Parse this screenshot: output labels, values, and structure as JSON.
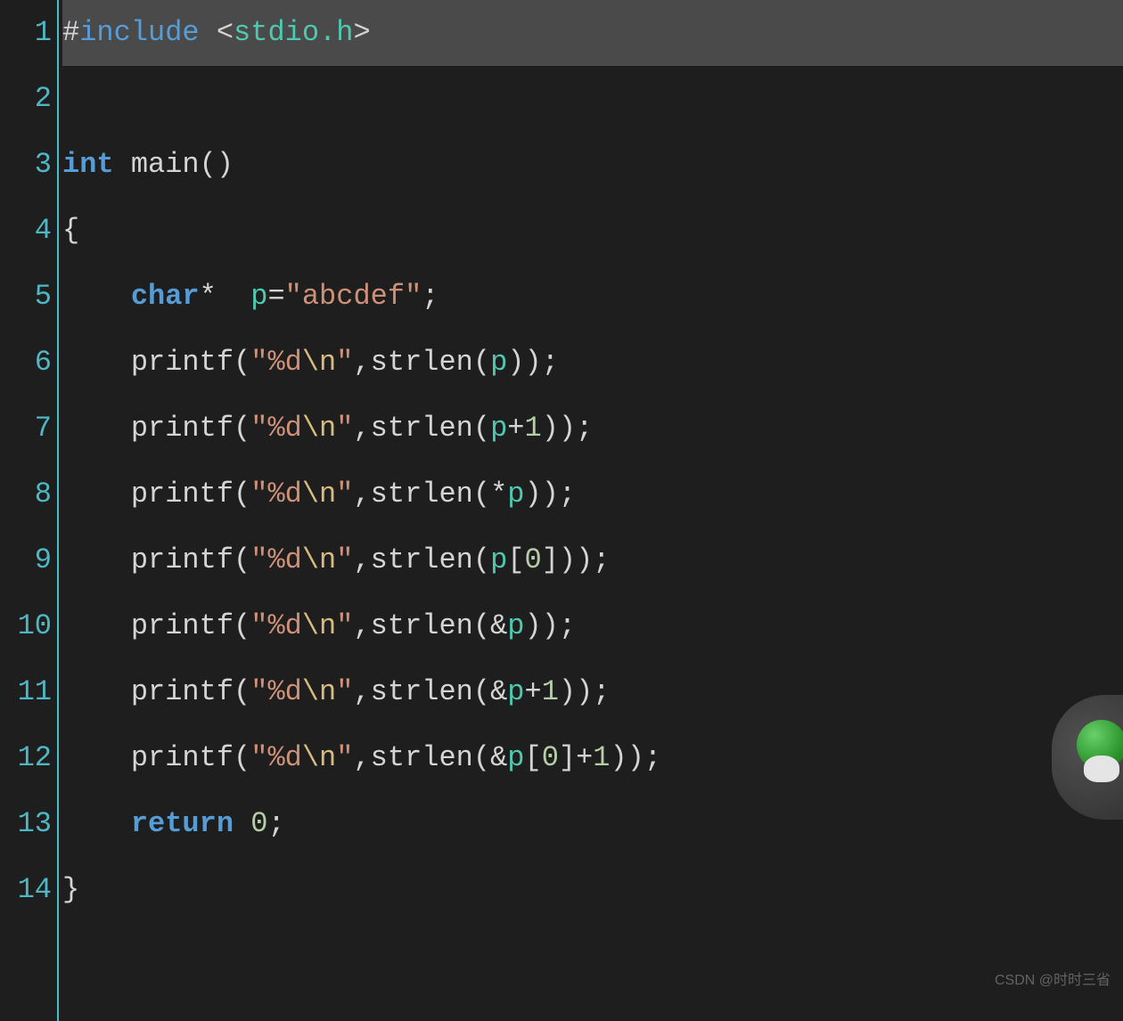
{
  "editor": {
    "highlighted_line_index": 0,
    "lines": [
      {
        "number": "1",
        "tokens": [
          {
            "text": "#",
            "class": "tok-hash"
          },
          {
            "text": "include",
            "class": "tok-preprocessor"
          },
          {
            "text": " ",
            "class": "tok-punct"
          },
          {
            "text": "<",
            "class": "tok-angle"
          },
          {
            "text": "stdio.h",
            "class": "tok-include-path"
          },
          {
            "text": ">",
            "class": "tok-angle"
          }
        ]
      },
      {
        "number": "2",
        "tokens": []
      },
      {
        "number": "3",
        "tokens": [
          {
            "text": "int",
            "class": "tok-type"
          },
          {
            "text": " ",
            "class": "tok-punct"
          },
          {
            "text": "main",
            "class": "tok-function"
          },
          {
            "text": "()",
            "class": "tok-punct"
          }
        ]
      },
      {
        "number": "4",
        "tokens": [
          {
            "text": "{",
            "class": "tok-punct"
          }
        ]
      },
      {
        "number": "5",
        "indent": true,
        "tokens": [
          {
            "text": "    ",
            "class": "tok-punct"
          },
          {
            "text": "char",
            "class": "tok-type"
          },
          {
            "text": "*  ",
            "class": "tok-punct"
          },
          {
            "text": "p",
            "class": "tok-variable"
          },
          {
            "text": "=",
            "class": "tok-punct"
          },
          {
            "text": "\"abcdef\"",
            "class": "tok-string"
          },
          {
            "text": ";",
            "class": "tok-punct"
          }
        ]
      },
      {
        "number": "6",
        "indent": true,
        "tokens": [
          {
            "text": "    ",
            "class": "tok-punct"
          },
          {
            "text": "printf",
            "class": "tok-function"
          },
          {
            "text": "(",
            "class": "tok-punct"
          },
          {
            "text": "\"%d",
            "class": "tok-string"
          },
          {
            "text": "\\n",
            "class": "tok-escape"
          },
          {
            "text": "\"",
            "class": "tok-string"
          },
          {
            "text": ",",
            "class": "tok-punct"
          },
          {
            "text": "strlen",
            "class": "tok-function"
          },
          {
            "text": "(",
            "class": "tok-punct"
          },
          {
            "text": "p",
            "class": "tok-variable"
          },
          {
            "text": "));",
            "class": "tok-punct"
          }
        ]
      },
      {
        "number": "7",
        "indent": true,
        "tokens": [
          {
            "text": "    ",
            "class": "tok-punct"
          },
          {
            "text": "printf",
            "class": "tok-function"
          },
          {
            "text": "(",
            "class": "tok-punct"
          },
          {
            "text": "\"%d",
            "class": "tok-string"
          },
          {
            "text": "\\n",
            "class": "tok-escape"
          },
          {
            "text": "\"",
            "class": "tok-string"
          },
          {
            "text": ",",
            "class": "tok-punct"
          },
          {
            "text": "strlen",
            "class": "tok-function"
          },
          {
            "text": "(",
            "class": "tok-punct"
          },
          {
            "text": "p",
            "class": "tok-variable"
          },
          {
            "text": "+",
            "class": "tok-punct"
          },
          {
            "text": "1",
            "class": "tok-number"
          },
          {
            "text": "));",
            "class": "tok-punct"
          }
        ]
      },
      {
        "number": "8",
        "indent": true,
        "tokens": [
          {
            "text": "    ",
            "class": "tok-punct"
          },
          {
            "text": "printf",
            "class": "tok-function"
          },
          {
            "text": "(",
            "class": "tok-punct"
          },
          {
            "text": "\"%d",
            "class": "tok-string"
          },
          {
            "text": "\\n",
            "class": "tok-escape"
          },
          {
            "text": "\"",
            "class": "tok-string"
          },
          {
            "text": ",",
            "class": "tok-punct"
          },
          {
            "text": "strlen",
            "class": "tok-function"
          },
          {
            "text": "(*",
            "class": "tok-punct"
          },
          {
            "text": "p",
            "class": "tok-variable"
          },
          {
            "text": "));",
            "class": "tok-punct"
          }
        ]
      },
      {
        "number": "9",
        "indent": true,
        "tokens": [
          {
            "text": "    ",
            "class": "tok-punct"
          },
          {
            "text": "printf",
            "class": "tok-function"
          },
          {
            "text": "(",
            "class": "tok-punct"
          },
          {
            "text": "\"%d",
            "class": "tok-string"
          },
          {
            "text": "\\n",
            "class": "tok-escape"
          },
          {
            "text": "\"",
            "class": "tok-string"
          },
          {
            "text": ",",
            "class": "tok-punct"
          },
          {
            "text": "strlen",
            "class": "tok-function"
          },
          {
            "text": "(",
            "class": "tok-punct"
          },
          {
            "text": "p",
            "class": "tok-variable"
          },
          {
            "text": "[",
            "class": "tok-punct"
          },
          {
            "text": "0",
            "class": "tok-number"
          },
          {
            "text": "]));",
            "class": "tok-punct"
          }
        ]
      },
      {
        "number": "10",
        "indent": true,
        "tokens": [
          {
            "text": "    ",
            "class": "tok-punct"
          },
          {
            "text": "printf",
            "class": "tok-function"
          },
          {
            "text": "(",
            "class": "tok-punct"
          },
          {
            "text": "\"%d",
            "class": "tok-string"
          },
          {
            "text": "\\n",
            "class": "tok-escape"
          },
          {
            "text": "\"",
            "class": "tok-string"
          },
          {
            "text": ",",
            "class": "tok-punct"
          },
          {
            "text": "strlen",
            "class": "tok-function"
          },
          {
            "text": "(&",
            "class": "tok-punct"
          },
          {
            "text": "p",
            "class": "tok-variable"
          },
          {
            "text": "));",
            "class": "tok-punct"
          }
        ]
      },
      {
        "number": "11",
        "indent": true,
        "tokens": [
          {
            "text": "    ",
            "class": "tok-punct"
          },
          {
            "text": "printf",
            "class": "tok-function"
          },
          {
            "text": "(",
            "class": "tok-punct"
          },
          {
            "text": "\"%d",
            "class": "tok-string"
          },
          {
            "text": "\\n",
            "class": "tok-escape"
          },
          {
            "text": "\"",
            "class": "tok-string"
          },
          {
            "text": ",",
            "class": "tok-punct"
          },
          {
            "text": "strlen",
            "class": "tok-function"
          },
          {
            "text": "(&",
            "class": "tok-punct"
          },
          {
            "text": "p",
            "class": "tok-variable"
          },
          {
            "text": "+",
            "class": "tok-punct"
          },
          {
            "text": "1",
            "class": "tok-number"
          },
          {
            "text": "));",
            "class": "tok-punct"
          }
        ]
      },
      {
        "number": "12",
        "indent": true,
        "tokens": [
          {
            "text": "    ",
            "class": "tok-punct"
          },
          {
            "text": "printf",
            "class": "tok-function"
          },
          {
            "text": "(",
            "class": "tok-punct"
          },
          {
            "text": "\"%d",
            "class": "tok-string"
          },
          {
            "text": "\\n",
            "class": "tok-escape"
          },
          {
            "text": "\"",
            "class": "tok-string"
          },
          {
            "text": ",",
            "class": "tok-punct"
          },
          {
            "text": "strlen",
            "class": "tok-function"
          },
          {
            "text": "(&",
            "class": "tok-punct"
          },
          {
            "text": "p",
            "class": "tok-variable"
          },
          {
            "text": "[",
            "class": "tok-punct"
          },
          {
            "text": "0",
            "class": "tok-number"
          },
          {
            "text": "]+",
            "class": "tok-punct"
          },
          {
            "text": "1",
            "class": "tok-number"
          },
          {
            "text": "));",
            "class": "tok-punct"
          }
        ]
      },
      {
        "number": "13",
        "indent": true,
        "tokens": [
          {
            "text": "    ",
            "class": "tok-punct"
          },
          {
            "text": "return",
            "class": "tok-keyword"
          },
          {
            "text": " ",
            "class": "tok-punct"
          },
          {
            "text": "0",
            "class": "tok-number"
          },
          {
            "text": ";",
            "class": "tok-punct"
          }
        ]
      },
      {
        "number": "14",
        "tokens": [
          {
            "text": "}",
            "class": "tok-punct"
          }
        ]
      }
    ]
  },
  "watermark": "CSDN @时时三省"
}
